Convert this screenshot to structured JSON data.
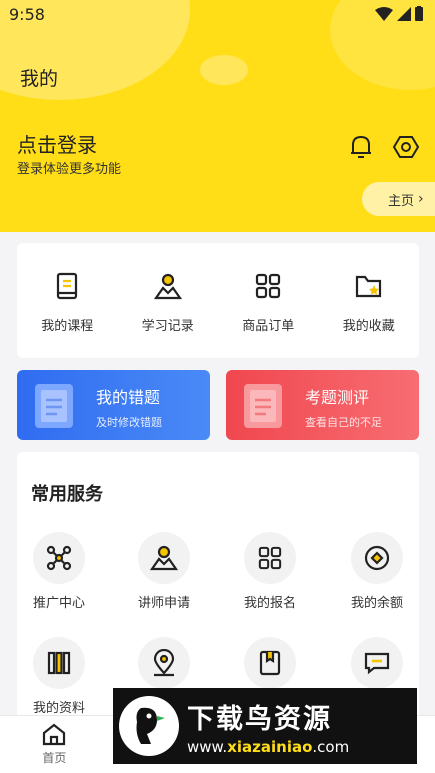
{
  "status": {
    "time": "9:58"
  },
  "header": {
    "title": "我的",
    "login_title": "点击登录",
    "login_subtitle": "登录体验更多功能",
    "home_label": "主页"
  },
  "quick_actions": [
    {
      "label": "我的课程",
      "icon": "book-icon"
    },
    {
      "label": "学习记录",
      "icon": "person-record-icon"
    },
    {
      "label": "商品订单",
      "icon": "grid-icon"
    },
    {
      "label": "我的收藏",
      "icon": "folder-star-icon"
    }
  ],
  "banners": {
    "errors": {
      "title": "我的错题",
      "subtitle": "及时修改错题"
    },
    "exam": {
      "title": "考题测评",
      "subtitle": "查看自己的不足"
    }
  },
  "services": {
    "title": "常用服务",
    "items": [
      {
        "label": "推广中心",
        "icon": "network-icon"
      },
      {
        "label": "讲师申请",
        "icon": "teacher-icon"
      },
      {
        "label": "我的报名",
        "icon": "grid-icon"
      },
      {
        "label": "我的余额",
        "icon": "coin-icon"
      },
      {
        "label": "我的资料",
        "icon": "books-icon"
      },
      {
        "label": "",
        "icon": "location-icon"
      },
      {
        "label": "",
        "icon": "bookmark-book-icon"
      },
      {
        "label": "",
        "icon": "message-icon"
      }
    ]
  },
  "bottom_nav": [
    {
      "label": "首页",
      "icon": "home-icon"
    },
    {
      "label": "",
      "icon": "tab-2-icon"
    },
    {
      "label": "",
      "icon": "tab-3-icon"
    },
    {
      "label": "",
      "icon": "tab-4-icon"
    }
  ],
  "watermark": {
    "title": "下载鸟资源",
    "url_prefix": "www.",
    "url_main": "xiazainiao",
    "url_suffix": ".com"
  },
  "colors": {
    "header_yellow": "#ffde17",
    "blue_banner": "#2f6cf1",
    "red_banner": "#f0474f",
    "icon_yellow": "#f5c400"
  }
}
